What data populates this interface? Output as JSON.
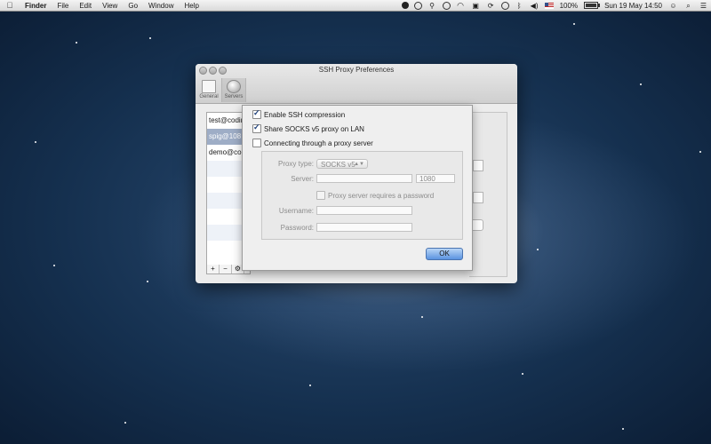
{
  "menubar": {
    "apple_icon": "apple-icon",
    "items": [
      "Finder",
      "File",
      "Edit",
      "View",
      "Go",
      "Window",
      "Help"
    ],
    "battery": "100%",
    "datetime": "Sun 19 May  14:50"
  },
  "window": {
    "title": "SSH Proxy Preferences",
    "toolbar": [
      {
        "label": "General",
        "icon": "general-icon"
      },
      {
        "label": "Servers",
        "icon": "servers-icon"
      }
    ],
    "servers": [
      "test@codin",
      "spig@108",
      "demo@cod"
    ],
    "list_buttons": [
      "+",
      "−",
      "⚙"
    ]
  },
  "sheet": {
    "enable_compression": "Enable SSH compression",
    "share_socks": "Share SOCKS v5 proxy on LAN",
    "through_proxy": "Connecting through a proxy server",
    "proxy_type_label": "Proxy type:",
    "proxy_type_value": "SOCKS v5",
    "server_label": "Server:",
    "server_value": "",
    "port_value": "1080",
    "requires_password": "Proxy server requires a password",
    "username_label": "Username:",
    "password_label": "Password:",
    "ok_label": "OK"
  },
  "colors": {
    "accent": "#5a93e0",
    "selection": "#9eadc6"
  }
}
